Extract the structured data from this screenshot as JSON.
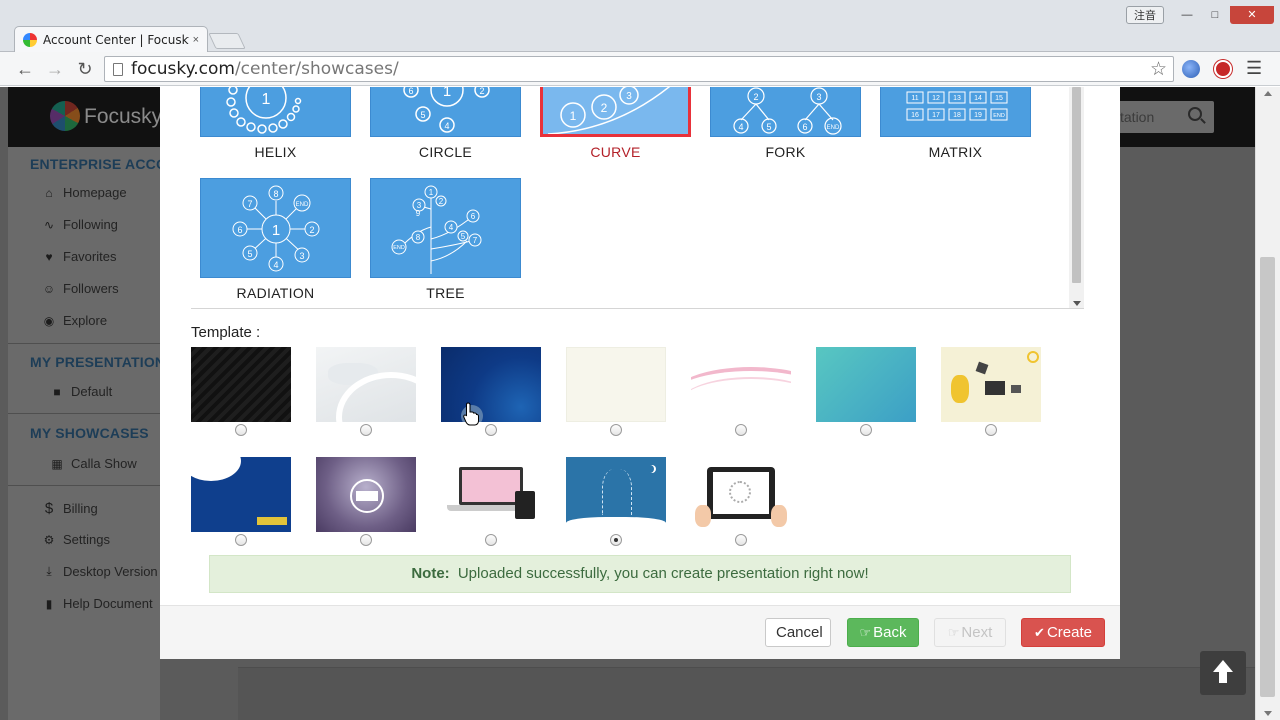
{
  "browser": {
    "tab_title": "Account Center | Focusky",
    "tab_close": "×",
    "url_host": "focusky.com",
    "url_path": "/center/showcases/",
    "ime_label": "注音",
    "icons": [
      "back-arrow-icon",
      "forward-arrow-icon",
      "reload-icon",
      "star-icon",
      "globe-icon",
      "block-icon",
      "menu-icon"
    ]
  },
  "site": {
    "logo_text": "Focusky",
    "search_placeholder": "tation",
    "sidebar": {
      "sections": [
        {
          "title": "ENTERPRISE ACCOUNT",
          "items": [
            "Homepage",
            "Following",
            "Favorites",
            "Followers",
            "Explore"
          ]
        },
        {
          "title": "MY PRESENTATIONS",
          "items": [
            "Default"
          ]
        },
        {
          "title": "MY SHOWCASES",
          "items": [
            "Calla Show"
          ]
        },
        {
          "title": "",
          "items": [
            "Billing",
            "Settings",
            "Desktop Version",
            "Help Document"
          ]
        }
      ]
    }
  },
  "modal": {
    "layouts": [
      {
        "label": "HELIX",
        "selected": false
      },
      {
        "label": "CIRCLE",
        "selected": false
      },
      {
        "label": "CURVE",
        "selected": true
      },
      {
        "label": "FORK",
        "selected": false
      },
      {
        "label": "MATRIX",
        "selected": false
      },
      {
        "label": "RADIATION",
        "selected": false
      },
      {
        "label": "TREE",
        "selected": false
      }
    ],
    "layout_thumb_text": {
      "helix": [
        "1"
      ],
      "circle": [
        "1",
        "6",
        "2",
        "5",
        "4"
      ],
      "curve": [
        "1",
        "2",
        "3"
      ],
      "fork": [
        "2",
        "3",
        "4",
        "5",
        "6",
        "END"
      ],
      "matrix": [
        "11",
        "12",
        "13",
        "14",
        "15",
        "16",
        "17",
        "18",
        "19",
        "END"
      ],
      "radiation": [
        "1",
        "8",
        "END",
        "7",
        "2",
        "6",
        "3",
        "5",
        "4"
      ],
      "tree": [
        "1",
        "2",
        "3",
        "4",
        "5",
        "6",
        "7",
        "8",
        "9",
        "END"
      ]
    },
    "template_label": "Template :",
    "templates_selected_index": 10,
    "template_count": 12,
    "note_label": "Note:",
    "note_text": "Uploaded successfully, you can create presentation right now!",
    "buttons": {
      "cancel": "Cancel",
      "back": "Back",
      "next": "Next",
      "create": "Create"
    },
    "colors": {
      "layout_blue": "#4c9ee0",
      "selected_border": "#e8313a",
      "back_green": "#5cb85c",
      "create_red": "#d9534f",
      "note_bg": "#e4f0dc"
    }
  }
}
